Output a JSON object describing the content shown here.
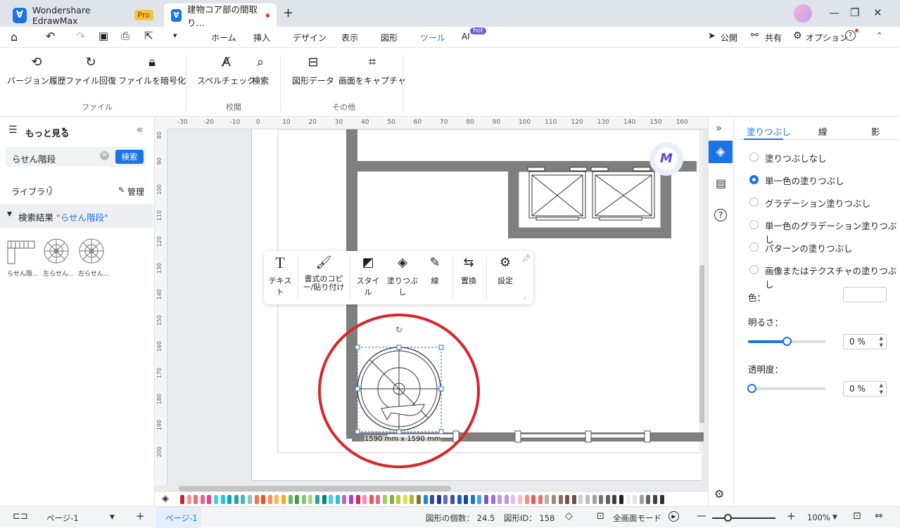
{
  "titlebar": {
    "app_title": "Wondershare EdrawMax",
    "pro_badge": "Pro",
    "doc_tab_title": "建物コア部の間取り...",
    "new_tab": "+",
    "win_min": "—",
    "win_restore": "❐",
    "win_close": "✕"
  },
  "menubar": {
    "items": [
      "ホーム",
      "挿入",
      "デザイン",
      "表示",
      "図形",
      "ツール",
      "AI"
    ],
    "ai_badge": "hot",
    "publish": "公開",
    "share": "共有",
    "options": "オプション",
    "help": "?"
  },
  "ribbon": {
    "buttons": [
      "バージョン履歴",
      "ファイル回復",
      "ファイルを暗号化",
      "スペルチェック",
      "検索",
      "図形データ",
      "画面をキャプチャ"
    ],
    "groups": [
      "ファイル",
      "校閲",
      "その他"
    ]
  },
  "left_panel": {
    "header": "もっと見る",
    "search_value": "らせん階段",
    "search_button": "検索",
    "library_label": "ライブラリ",
    "manage_label": "管理",
    "result_prefix": "検索結果",
    "result_query": "\"らせん階段\"",
    "shapes": [
      "らせん階...",
      "左らせん...",
      "左らせん..."
    ]
  },
  "canvas": {
    "ruler_h": [
      "-30",
      "-20",
      "-10",
      "0",
      "10",
      "20",
      "30",
      "40",
      "50",
      "60",
      "70",
      "80",
      "90",
      "100",
      "110",
      "120",
      "130",
      "140",
      "150",
      "160"
    ],
    "ruler_v": [
      "80",
      "90",
      "100",
      "110",
      "120",
      "130",
      "140",
      "150",
      "160",
      "170",
      "180",
      "190",
      "200"
    ],
    "dimension_label": "1590 mm x 1590 mm",
    "float_toolbar": [
      "テキスト",
      "書式のコピー/貼り付け",
      "スタイル",
      "塗りつぶし",
      "線",
      "置換",
      "設定"
    ]
  },
  "right_panel": {
    "tabs": [
      "塗りつぶし",
      "線",
      "影"
    ],
    "fill_options": [
      "塗りつぶしなし",
      "単一色の塗りつぶし",
      "グラデーション塗りつぶし",
      "単一色のグラデーション塗りつぶし",
      "パターンの塗りつぶし",
      "画像またはテクスチャの塗りつぶし"
    ],
    "selected_option": 1,
    "color_label": "色：",
    "brightness_label": "明るさ：",
    "brightness_value": "0 %",
    "transparency_label": "透明度：",
    "transparency_value": "0 %"
  },
  "statusbar": {
    "page_select": "ページ-1",
    "add_page": "+",
    "active_page": "ページ-1",
    "shape_count": "図形の個数：  24.5",
    "shape_id": "図形ID：  158",
    "fullscreen": "全画面モード",
    "zoom": "100%"
  },
  "colors": {
    "accent": "#1b73e8",
    "wall": "#7f7f7f",
    "highlight_circle": "#d9262a"
  }
}
